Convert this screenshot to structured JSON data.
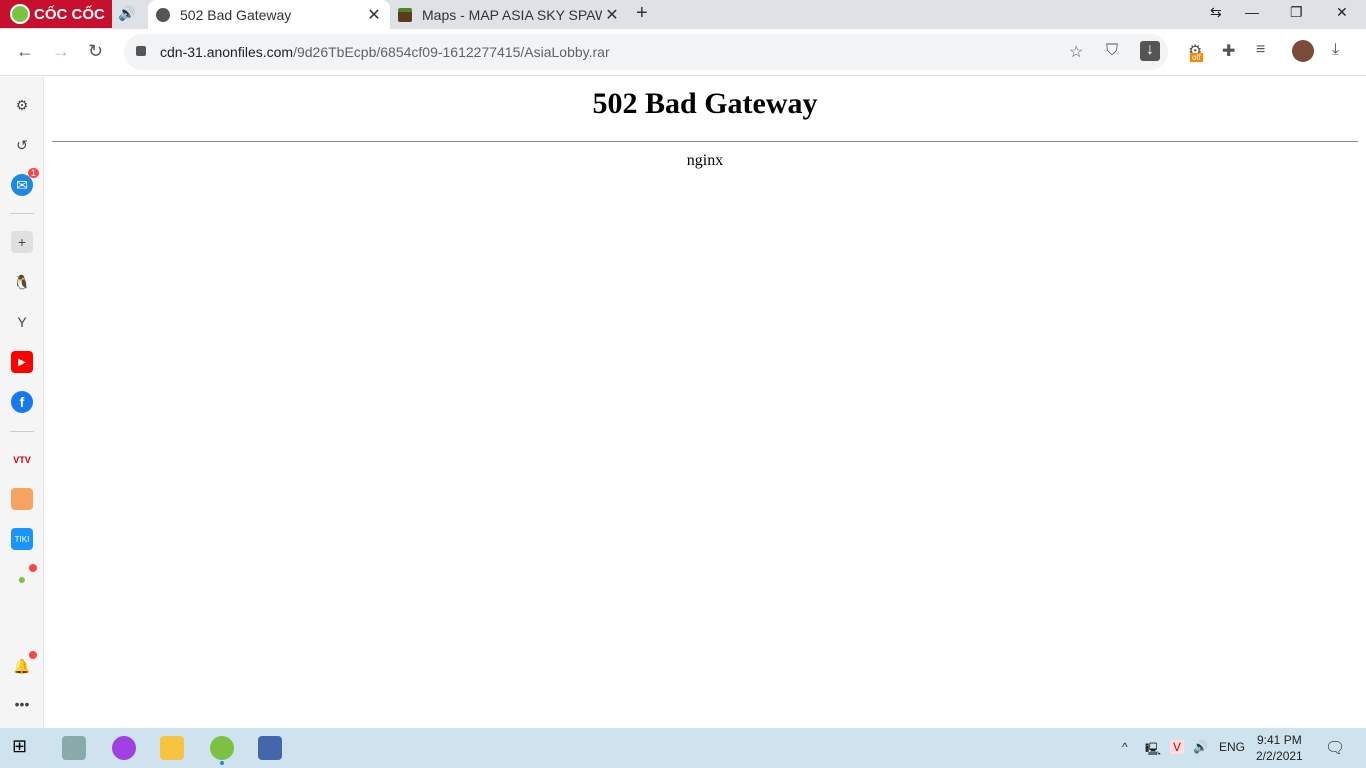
{
  "browser": {
    "logo_text": "CỐC CỐC"
  },
  "tabs": [
    {
      "title": "502 Bad Gateway",
      "active": true
    },
    {
      "title": "Maps - MAP ASIA SKY SPAWN",
      "active": false
    }
  ],
  "address": {
    "host": "cdn-31.anonfiles.com",
    "path": "/9d26TbEcpb/6854cf09-1612277415/AsiaLobby.rar"
  },
  "extension_badge": "off",
  "sidebar": {
    "messenger_badge": "1"
  },
  "page": {
    "heading": "502 Bad Gateway",
    "server": "nginx"
  },
  "taskbar": {
    "language": "ENG",
    "time": "9:41 PM",
    "date": "2/2/2021"
  }
}
